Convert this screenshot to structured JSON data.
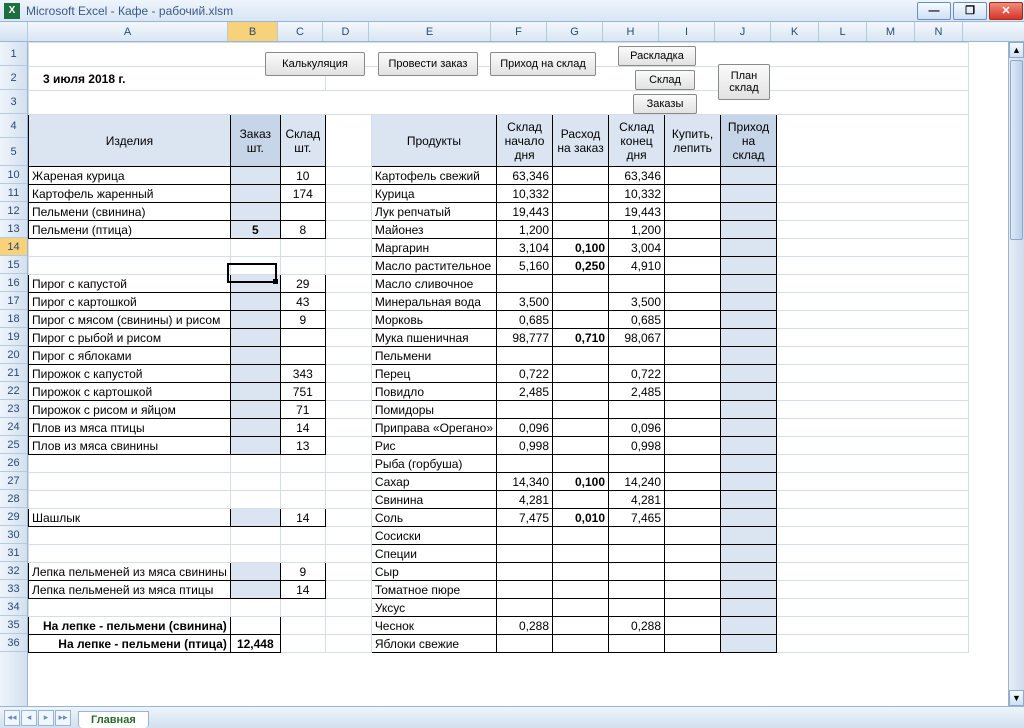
{
  "app": {
    "title": "Microsoft Excel - Кафе - рабочий.xlsm"
  },
  "date": "3 июля 2018 г.",
  "columns": [
    "A",
    "B",
    "C",
    "D",
    "E",
    "F",
    "G",
    "H",
    "I",
    "J",
    "K",
    "L",
    "M",
    "N"
  ],
  "active_column": "B",
  "row_headers": [
    1,
    2,
    3,
    4,
    5,
    10,
    11,
    12,
    13,
    14,
    15,
    16,
    17,
    18,
    19,
    20,
    21,
    22,
    23,
    24,
    25,
    26,
    27,
    28,
    29,
    30,
    31,
    32,
    33,
    34,
    35,
    36
  ],
  "active_row": 14,
  "buttons": {
    "calc": "Калькуляция",
    "order": "Провести заказ",
    "arrival": "Приход на склад",
    "layout": "Раскладка",
    "stock": "Склад",
    "orders": "Заказы",
    "plan": "План\nсклад"
  },
  "left_head": {
    "item": "Изделия",
    "order": "Заказ\nшт.",
    "stock": "Склад\nшт."
  },
  "right_head": {
    "product": "Продукты",
    "start": "Склад\nначало\nдня",
    "spend": "Расход\nна заказ",
    "end": "Склад\nконец\nдня",
    "buy": "Купить,\nлепить",
    "arrival": "Приход\nна\nсклад"
  },
  "left_rows": [
    {
      "r": 10,
      "name": "Жареная курица",
      "order": "",
      "stock": "10"
    },
    {
      "r": 11,
      "name": "Картофель жаренный",
      "order": "",
      "stock": "174"
    },
    {
      "r": 12,
      "name": "Пельмени (свинина)",
      "order": "",
      "stock": ""
    },
    {
      "r": 13,
      "name": "Пельмени (птица)",
      "order": "5",
      "stock": "8"
    },
    {
      "r": 14,
      "name": "",
      "order": "",
      "stock": ""
    },
    {
      "r": 15,
      "name": "",
      "order": "",
      "stock": ""
    },
    {
      "r": 16,
      "name": "Пирог с капустой",
      "order": "",
      "stock": "29"
    },
    {
      "r": 17,
      "name": "Пирог с картошкой",
      "order": "",
      "stock": "43"
    },
    {
      "r": 18,
      "name": "Пирог с мясом (свинины) и рисом",
      "order": "",
      "stock": "9"
    },
    {
      "r": 19,
      "name": "Пирог с рыбой  и рисом",
      "order": "",
      "stock": ""
    },
    {
      "r": 20,
      "name": "Пирог с яблоками",
      "order": "",
      "stock": ""
    },
    {
      "r": 21,
      "name": "Пирожок с капустой",
      "order": "",
      "stock": "343"
    },
    {
      "r": 22,
      "name": "Пирожок с картошкой",
      "order": "",
      "stock": "751"
    },
    {
      "r": 23,
      "name": "Пирожок с рисом и яйцом",
      "order": "",
      "stock": "71"
    },
    {
      "r": 24,
      "name": "Плов из мяса птицы",
      "order": "",
      "stock": "14"
    },
    {
      "r": 25,
      "name": "Плов из мяса свинины",
      "order": "",
      "stock": "13"
    },
    {
      "r": 26,
      "name": "",
      "order": "",
      "stock": ""
    },
    {
      "r": 27,
      "name": "",
      "order": "",
      "stock": ""
    },
    {
      "r": 28,
      "name": "",
      "order": "",
      "stock": ""
    },
    {
      "r": 29,
      "name": "Шашлык",
      "order": "",
      "stock": "14"
    },
    {
      "r": 30,
      "name": "",
      "order": "",
      "stock": ""
    },
    {
      "r": 31,
      "name": "",
      "order": "",
      "stock": ""
    },
    {
      "r": 32,
      "name": "Лепка пельменей из мяса свинины",
      "order": "",
      "stock": "9"
    },
    {
      "r": 33,
      "name": "Лепка пельменей из мяса птицы",
      "order": "",
      "stock": "14"
    }
  ],
  "lepka": {
    "pork": "На лепке - пельмени (свинина)",
    "bird": "На лепке - пельмени (птица)",
    "val": "12,448"
  },
  "right_rows": [
    {
      "name": "Картофель свежий",
      "start": "63,346",
      "spend": "",
      "end": "63,346",
      "buy": "",
      "arr": ""
    },
    {
      "name": "Курица",
      "start": "10,332",
      "spend": "",
      "end": "10,332",
      "buy": "",
      "arr": ""
    },
    {
      "name": "Лук репчатый",
      "start": "19,443",
      "spend": "",
      "end": "19,443",
      "buy": "",
      "arr": ""
    },
    {
      "name": "Майонез",
      "start": "1,200",
      "spend": "",
      "end": "1,200",
      "buy": "",
      "arr": ""
    },
    {
      "name": "Маргарин",
      "start": "3,104",
      "spend": "0,100",
      "spend_bold": true,
      "end": "3,004",
      "buy": "",
      "arr": ""
    },
    {
      "name": "Масло растительное",
      "start": "5,160",
      "spend": "0,250",
      "spend_bold": true,
      "end": "4,910",
      "buy": "",
      "arr": ""
    },
    {
      "name": "Масло сливочное",
      "start": "",
      "spend": "",
      "end": "",
      "buy": "",
      "arr": ""
    },
    {
      "name": "Минеральная вода",
      "start": "3,500",
      "spend": "",
      "end": "3,500",
      "buy": "",
      "arr": ""
    },
    {
      "name": "Морковь",
      "start": "0,685",
      "spend": "",
      "end": "0,685",
      "buy": "",
      "arr": ""
    },
    {
      "name": "Мука пшеничная",
      "start": "98,777",
      "spend": "0,710",
      "spend_bold": true,
      "end": "98,067",
      "buy": "",
      "arr": ""
    },
    {
      "name": "Пельмени",
      "start": "",
      "spend": "",
      "end": "",
      "buy": "",
      "arr": ""
    },
    {
      "name": "Перец",
      "start": "0,722",
      "spend": "",
      "end": "0,722",
      "buy": "",
      "arr": ""
    },
    {
      "name": "Повидло",
      "start": "2,485",
      "spend": "",
      "end": "2,485",
      "buy": "",
      "arr": ""
    },
    {
      "name": "Помидоры",
      "start": "",
      "spend": "",
      "end": "",
      "buy": "",
      "arr": ""
    },
    {
      "name": "Приправа «Орегано»",
      "start": "0,096",
      "spend": "",
      "end": "0,096",
      "buy": "",
      "arr": ""
    },
    {
      "name": "Рис",
      "start": "0,998",
      "spend": "",
      "end": "0,998",
      "buy": "",
      "arr": ""
    },
    {
      "name": "Рыба (горбуша)",
      "start": "",
      "spend": "",
      "end": "",
      "buy": "",
      "arr": ""
    },
    {
      "name": "Сахар",
      "start": "14,340",
      "spend": "0,100",
      "spend_bold": true,
      "end": "14,240",
      "buy": "",
      "arr": ""
    },
    {
      "name": "Свинина",
      "start": "4,281",
      "spend": "",
      "end": "4,281",
      "buy": "",
      "arr": ""
    },
    {
      "name": "Соль",
      "start": "7,475",
      "spend": "0,010",
      "spend_bold": true,
      "end": "7,465",
      "buy": "",
      "arr": ""
    },
    {
      "name": "Сосиски",
      "start": "",
      "spend": "",
      "end": "",
      "buy": "",
      "arr": ""
    },
    {
      "name": "Специи",
      "start": "",
      "spend": "",
      "end": "",
      "buy": "",
      "arr": ""
    },
    {
      "name": "Сыр",
      "start": "",
      "spend": "",
      "end": "",
      "buy": "",
      "arr": ""
    },
    {
      "name": "Томатное пюре",
      "start": "",
      "spend": "",
      "end": "",
      "buy": "",
      "arr": ""
    },
    {
      "name": "Уксус",
      "start": "",
      "spend": "",
      "end": "",
      "buy": "",
      "arr": ""
    },
    {
      "name": "Чеснок",
      "start": "0,288",
      "spend": "",
      "end": "0,288",
      "buy": "",
      "arr": ""
    },
    {
      "name": "Яблоки свежие",
      "start": "",
      "spend": "",
      "end": "",
      "buy": "",
      "arr": ""
    }
  ],
  "sheet_tab": "Главная"
}
